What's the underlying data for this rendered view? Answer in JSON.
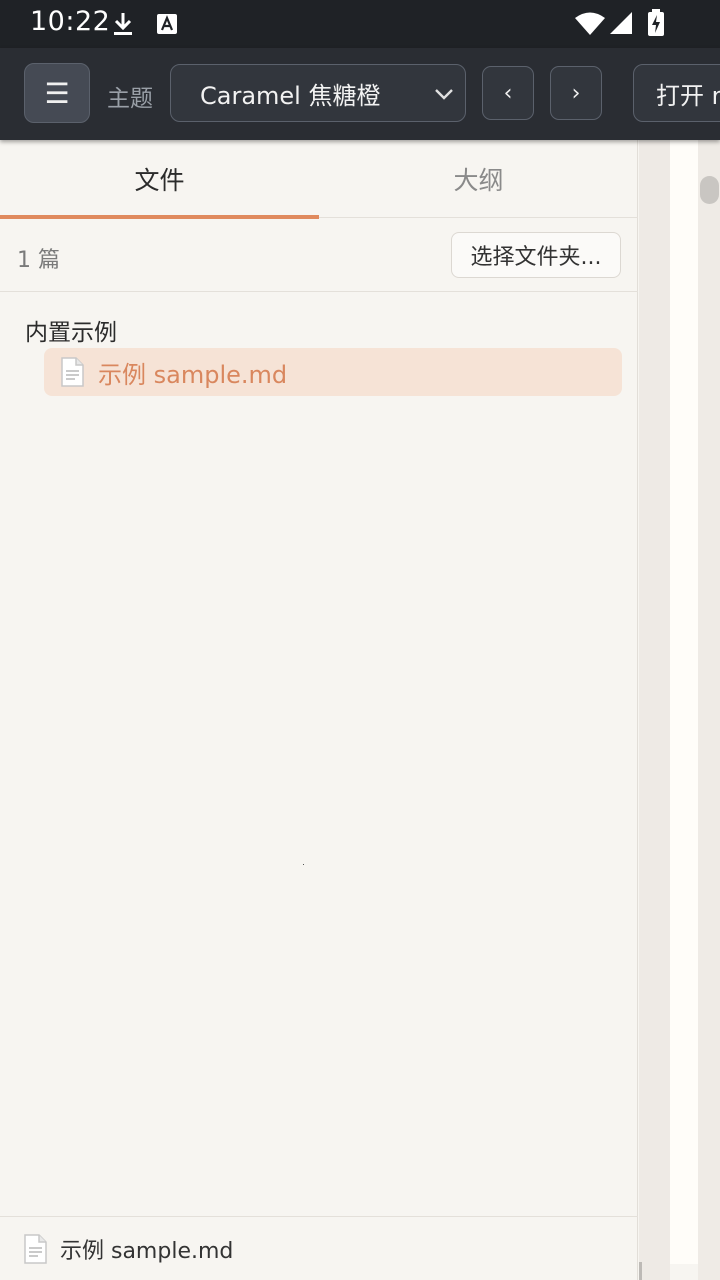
{
  "status_bar": {
    "time": "10:22",
    "icons": [
      "download-icon",
      "keyboard-a-icon",
      "wifi-icon",
      "signal-icon",
      "battery-charging-icon"
    ]
  },
  "toolbar": {
    "menu_icon": "☰",
    "theme_label": "主题",
    "theme_selected": "Caramel 焦糖橙",
    "prev_label": "‹",
    "next_label": "›",
    "open_label": "打开 md"
  },
  "sidebar": {
    "tabs": [
      {
        "label": "文件",
        "active": true
      },
      {
        "label": "大纲",
        "active": false
      }
    ],
    "count_label": "1 篇",
    "choose_folder_label": "选择文件夹...",
    "groups": [
      {
        "title": "内置示例",
        "files": [
          {
            "name": "示例 sample.md",
            "selected": true
          }
        ]
      }
    ],
    "current_file": "示例 sample.md"
  },
  "colors": {
    "accent": "#e08a5e",
    "selected_bg": "#f6e3d6",
    "toolbar_bg": "#2a2d33",
    "statusbar_bg": "#1f2226",
    "sidebar_bg": "#f7f5f1"
  }
}
